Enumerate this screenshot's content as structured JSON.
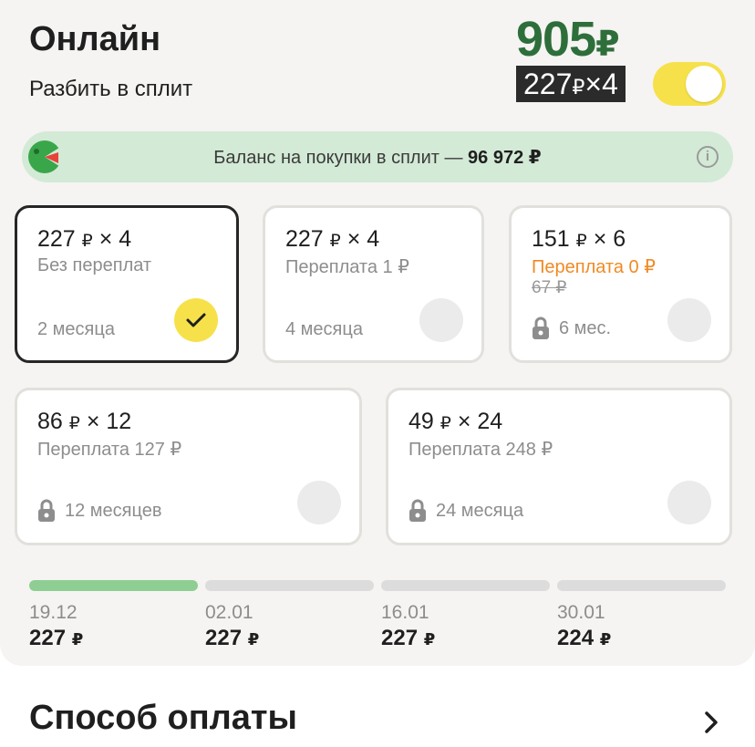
{
  "header": {
    "title": "Онлайн",
    "subtitle": "Разбить в сплит",
    "total_amount": "905",
    "total_currency": "₽",
    "split_amount": "227",
    "split_currency": "₽",
    "split_times": "×4",
    "toggle_on": true
  },
  "balance": {
    "label": "Баланс на покупки в сплит",
    "dash": "—",
    "amount": "96 972",
    "currency": "₽",
    "info_icon": "i"
  },
  "plans": [
    {
      "amount": "227",
      "currency": "₽",
      "times": "× 4",
      "overpay": "Без переплат",
      "term": "2 месяца",
      "locked": false,
      "selected": true
    },
    {
      "amount": "227",
      "currency": "₽",
      "times": "× 4",
      "overpay": "Переплата 1 ₽",
      "term": "4 месяца",
      "locked": false,
      "selected": false
    },
    {
      "amount": "151",
      "currency": "₽",
      "times": "× 6",
      "overpay": "Переплата 0 ₽",
      "old_overpay": "67 ₽",
      "term": "6 мес.",
      "locked": true,
      "selected": false
    },
    {
      "amount": "86",
      "currency": "₽",
      "times": "× 12",
      "overpay": "Переплата 127 ₽",
      "term": "12 месяцев",
      "locked": true,
      "selected": false
    },
    {
      "amount": "49",
      "currency": "₽",
      "times": "× 24",
      "overpay": "Переплата 248 ₽",
      "term": "24 месяца",
      "locked": true,
      "selected": false
    }
  ],
  "schedule": [
    {
      "date": "19.12",
      "amount": "227",
      "currency": "₽",
      "paid": true
    },
    {
      "date": "02.01",
      "amount": "227",
      "currency": "₽",
      "paid": false
    },
    {
      "date": "16.01",
      "amount": "227",
      "currency": "₽",
      "paid": false
    },
    {
      "date": "30.01",
      "amount": "224",
      "currency": "₽",
      "paid": false
    }
  ],
  "payment_method": {
    "title": "Способ оплаты"
  },
  "colors": {
    "accent_green": "#2e6e3a",
    "toggle_yellow": "#f6e14b",
    "balance_bg": "#d3ead6",
    "orange": "#f08a24",
    "progress_done": "#8fce93"
  }
}
